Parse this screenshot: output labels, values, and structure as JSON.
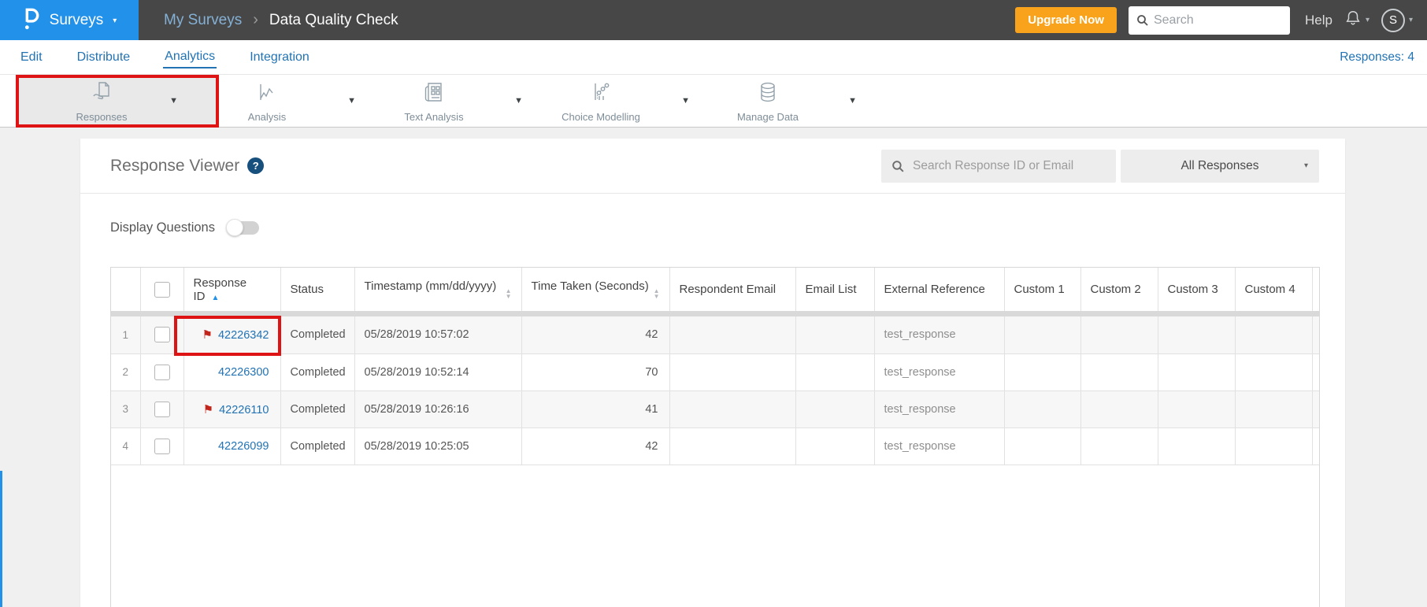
{
  "header": {
    "product": "Surveys",
    "breadcrumb": {
      "parent": "My Surveys",
      "separator": "›",
      "current": "Data Quality Check"
    },
    "upgrade_label": "Upgrade Now",
    "search_placeholder": "Search",
    "help_label": "Help",
    "avatar_letter": "S"
  },
  "nav": {
    "tabs": [
      {
        "label": "Edit",
        "active": false
      },
      {
        "label": "Distribute",
        "active": false
      },
      {
        "label": "Analytics",
        "active": true
      },
      {
        "label": "Integration",
        "active": false
      }
    ],
    "responses_count": "Responses: 4"
  },
  "toolbar": {
    "items": [
      {
        "label": "Responses",
        "icon": "responses-icon",
        "active": true,
        "annotated": true
      },
      {
        "label": "Analysis",
        "icon": "analysis-icon",
        "active": false,
        "annotated": false
      },
      {
        "label": "Text Analysis",
        "icon": "text-analysis-icon",
        "active": false,
        "annotated": false
      },
      {
        "label": "Choice Modelling",
        "icon": "choice-modelling-icon",
        "active": false,
        "annotated": false
      },
      {
        "label": "Manage Data",
        "icon": "manage-data-icon",
        "active": false,
        "annotated": false
      }
    ]
  },
  "panel": {
    "title": "Response Viewer",
    "help_icon": "?",
    "search_placeholder": "Search Response ID or Email",
    "filter_value": "All Responses",
    "display_questions_label": "Display Questions",
    "display_questions_on": false
  },
  "table": {
    "columns": [
      {
        "key": "num",
        "label": ""
      },
      {
        "key": "checkbox",
        "label": ""
      },
      {
        "key": "id",
        "label": "Response ID",
        "sort": "asc"
      },
      {
        "key": "status",
        "label": "Status"
      },
      {
        "key": "timestamp",
        "label": "Timestamp (mm/dd/yyyy)",
        "sort": "none"
      },
      {
        "key": "time_taken",
        "label": "Time Taken (Seconds)",
        "sort": "none"
      },
      {
        "key": "respondent_email",
        "label": "Respondent Email"
      },
      {
        "key": "email_list",
        "label": "Email List"
      },
      {
        "key": "external_reference",
        "label": "External Reference"
      },
      {
        "key": "custom1",
        "label": "Custom 1"
      },
      {
        "key": "custom2",
        "label": "Custom 2"
      },
      {
        "key": "custom3",
        "label": "Custom 3"
      },
      {
        "key": "custom4",
        "label": "Custom 4"
      },
      {
        "key": "spacer",
        "label": ""
      }
    ],
    "rows": [
      {
        "num": "1",
        "flagged": true,
        "annotated": true,
        "id": "42226342",
        "status": "Completed",
        "timestamp": "05/28/2019 10:57:02",
        "time_taken": "42",
        "respondent_email": "",
        "email_list": "",
        "external_reference": "test_response",
        "custom1": "",
        "custom2": "",
        "custom3": "",
        "custom4": ""
      },
      {
        "num": "2",
        "flagged": false,
        "annotated": false,
        "id": "42226300",
        "status": "Completed",
        "timestamp": "05/28/2019 10:52:14",
        "time_taken": "70",
        "respondent_email": "",
        "email_list": "",
        "external_reference": "test_response",
        "custom1": "",
        "custom2": "",
        "custom3": "",
        "custom4": ""
      },
      {
        "num": "3",
        "flagged": true,
        "annotated": false,
        "id": "42226110",
        "status": "Completed",
        "timestamp": "05/28/2019 10:26:16",
        "time_taken": "41",
        "respondent_email": "",
        "email_list": "",
        "external_reference": "test_response",
        "custom1": "",
        "custom2": "",
        "custom3": "",
        "custom4": ""
      },
      {
        "num": "4",
        "flagged": false,
        "annotated": false,
        "id": "42226099",
        "status": "Completed",
        "timestamp": "05/28/2019 10:25:05",
        "time_taken": "42",
        "respondent_email": "",
        "email_list": "",
        "external_reference": "test_response",
        "custom1": "",
        "custom2": "",
        "custom3": "",
        "custom4": ""
      }
    ]
  },
  "colors": {
    "brand_blue": "#2191ea",
    "upgrade_orange": "#f9a21c",
    "link_blue": "#2273b3",
    "flag_red": "#c1251b",
    "annotation_red": "#de1414"
  }
}
